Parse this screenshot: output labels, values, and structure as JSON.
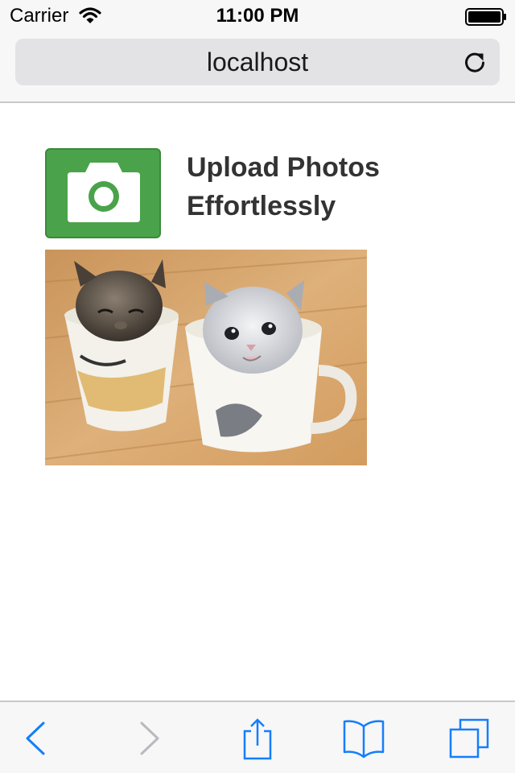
{
  "status_bar": {
    "carrier": "Carrier",
    "time": "11:00 PM",
    "wifi_icon": "wifi-icon",
    "battery_icon": "battery-icon"
  },
  "browser": {
    "address": "localhost",
    "reload_icon": "reload-icon"
  },
  "page": {
    "logo_icon": "camera-icon",
    "logo_color": "#4aa34a",
    "headline_line1": "Upload Photos",
    "headline_line2": "Effortlessly",
    "photo_subject": "two kittens sitting in mugs"
  },
  "toolbar": {
    "accent_color": "#157efb",
    "disabled_color": "#b9b9be",
    "items": [
      "back-icon",
      "forward-icon",
      "share-icon",
      "bookmarks-icon",
      "tabs-icon"
    ]
  }
}
